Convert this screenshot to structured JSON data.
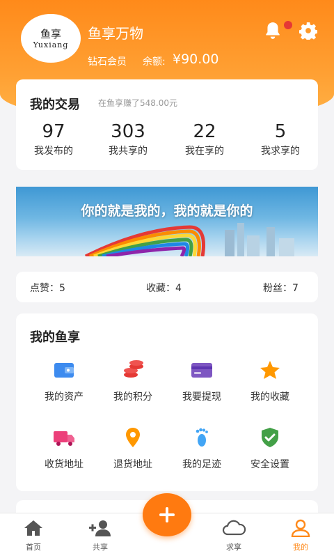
{
  "header": {
    "avatar_cn": "鱼享",
    "avatar_en": "Yuxiang",
    "username": "鱼享万物",
    "member_level": "钻石会员",
    "balance_label": "余额:",
    "balance_value": "¥90.00"
  },
  "trade": {
    "title": "我的交易",
    "subtitle": "在鱼享赚了548.00元",
    "stats": [
      {
        "num": "97",
        "label": "我发布的"
      },
      {
        "num": "303",
        "label": "我共享的"
      },
      {
        "num": "22",
        "label": "我在享的"
      },
      {
        "num": "5",
        "label": "我求享的"
      }
    ]
  },
  "banner": {
    "text": "你的就是我的，我的就是你的"
  },
  "social": {
    "likes": "点赞：5",
    "favorites": "收藏：4",
    "fans": "粉丝：7"
  },
  "myfish": {
    "title": "我的鱼享",
    "items": [
      {
        "label": "我的资产",
        "icon": "wallet-icon"
      },
      {
        "label": "我的积分",
        "icon": "coins-icon"
      },
      {
        "label": "我要提现",
        "icon": "card-icon"
      },
      {
        "label": "我的收藏",
        "icon": "star-icon"
      },
      {
        "label": "收货地址",
        "icon": "truck-icon"
      },
      {
        "label": "退货地址",
        "icon": "location-pin-icon"
      },
      {
        "label": "我的足迹",
        "icon": "footprint-icon"
      },
      {
        "label": "安全设置",
        "icon": "shield-check-icon"
      }
    ]
  },
  "tabbar": {
    "tabs": [
      {
        "label": "首页",
        "icon": "home-icon"
      },
      {
        "label": "共享",
        "icon": "add-user-icon"
      },
      {
        "label": "求享",
        "icon": "cloud-icon"
      },
      {
        "label": "我的",
        "icon": "person-icon",
        "active": true
      }
    ]
  },
  "colors": {
    "accent": "#ff8a1a",
    "fab": "#ff7a10"
  }
}
